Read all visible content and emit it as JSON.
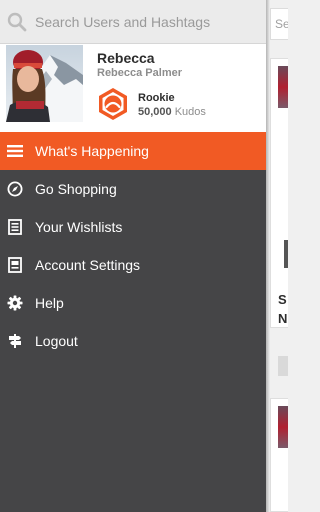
{
  "search": {
    "placeholder": "Search Users and Hashtags"
  },
  "profile": {
    "display_name": "Rebecca",
    "full_name": "Rebecca Palmer",
    "rank": "Rookie",
    "kudos_value": "50,000",
    "kudos_label": "Kudos"
  },
  "menu": {
    "items": [
      {
        "label": "What's Happening",
        "icon": "hamburger-icon",
        "active": true
      },
      {
        "label": "Go Shopping",
        "icon": "compass-icon"
      },
      {
        "label": "Your Wishlists",
        "icon": "list-icon"
      },
      {
        "label": "Account Settings",
        "icon": "account-card-icon"
      },
      {
        "label": "Help",
        "icon": "gear-icon"
      },
      {
        "label": "Logout",
        "icon": "signpost-icon"
      }
    ]
  },
  "feed": {
    "search_partial": "Se",
    "text_partial_1": "S",
    "text_partial_2": "N"
  },
  "colors": {
    "accent": "#f15a24",
    "drawer_bg": "#454547",
    "badge": "#f15a24"
  }
}
